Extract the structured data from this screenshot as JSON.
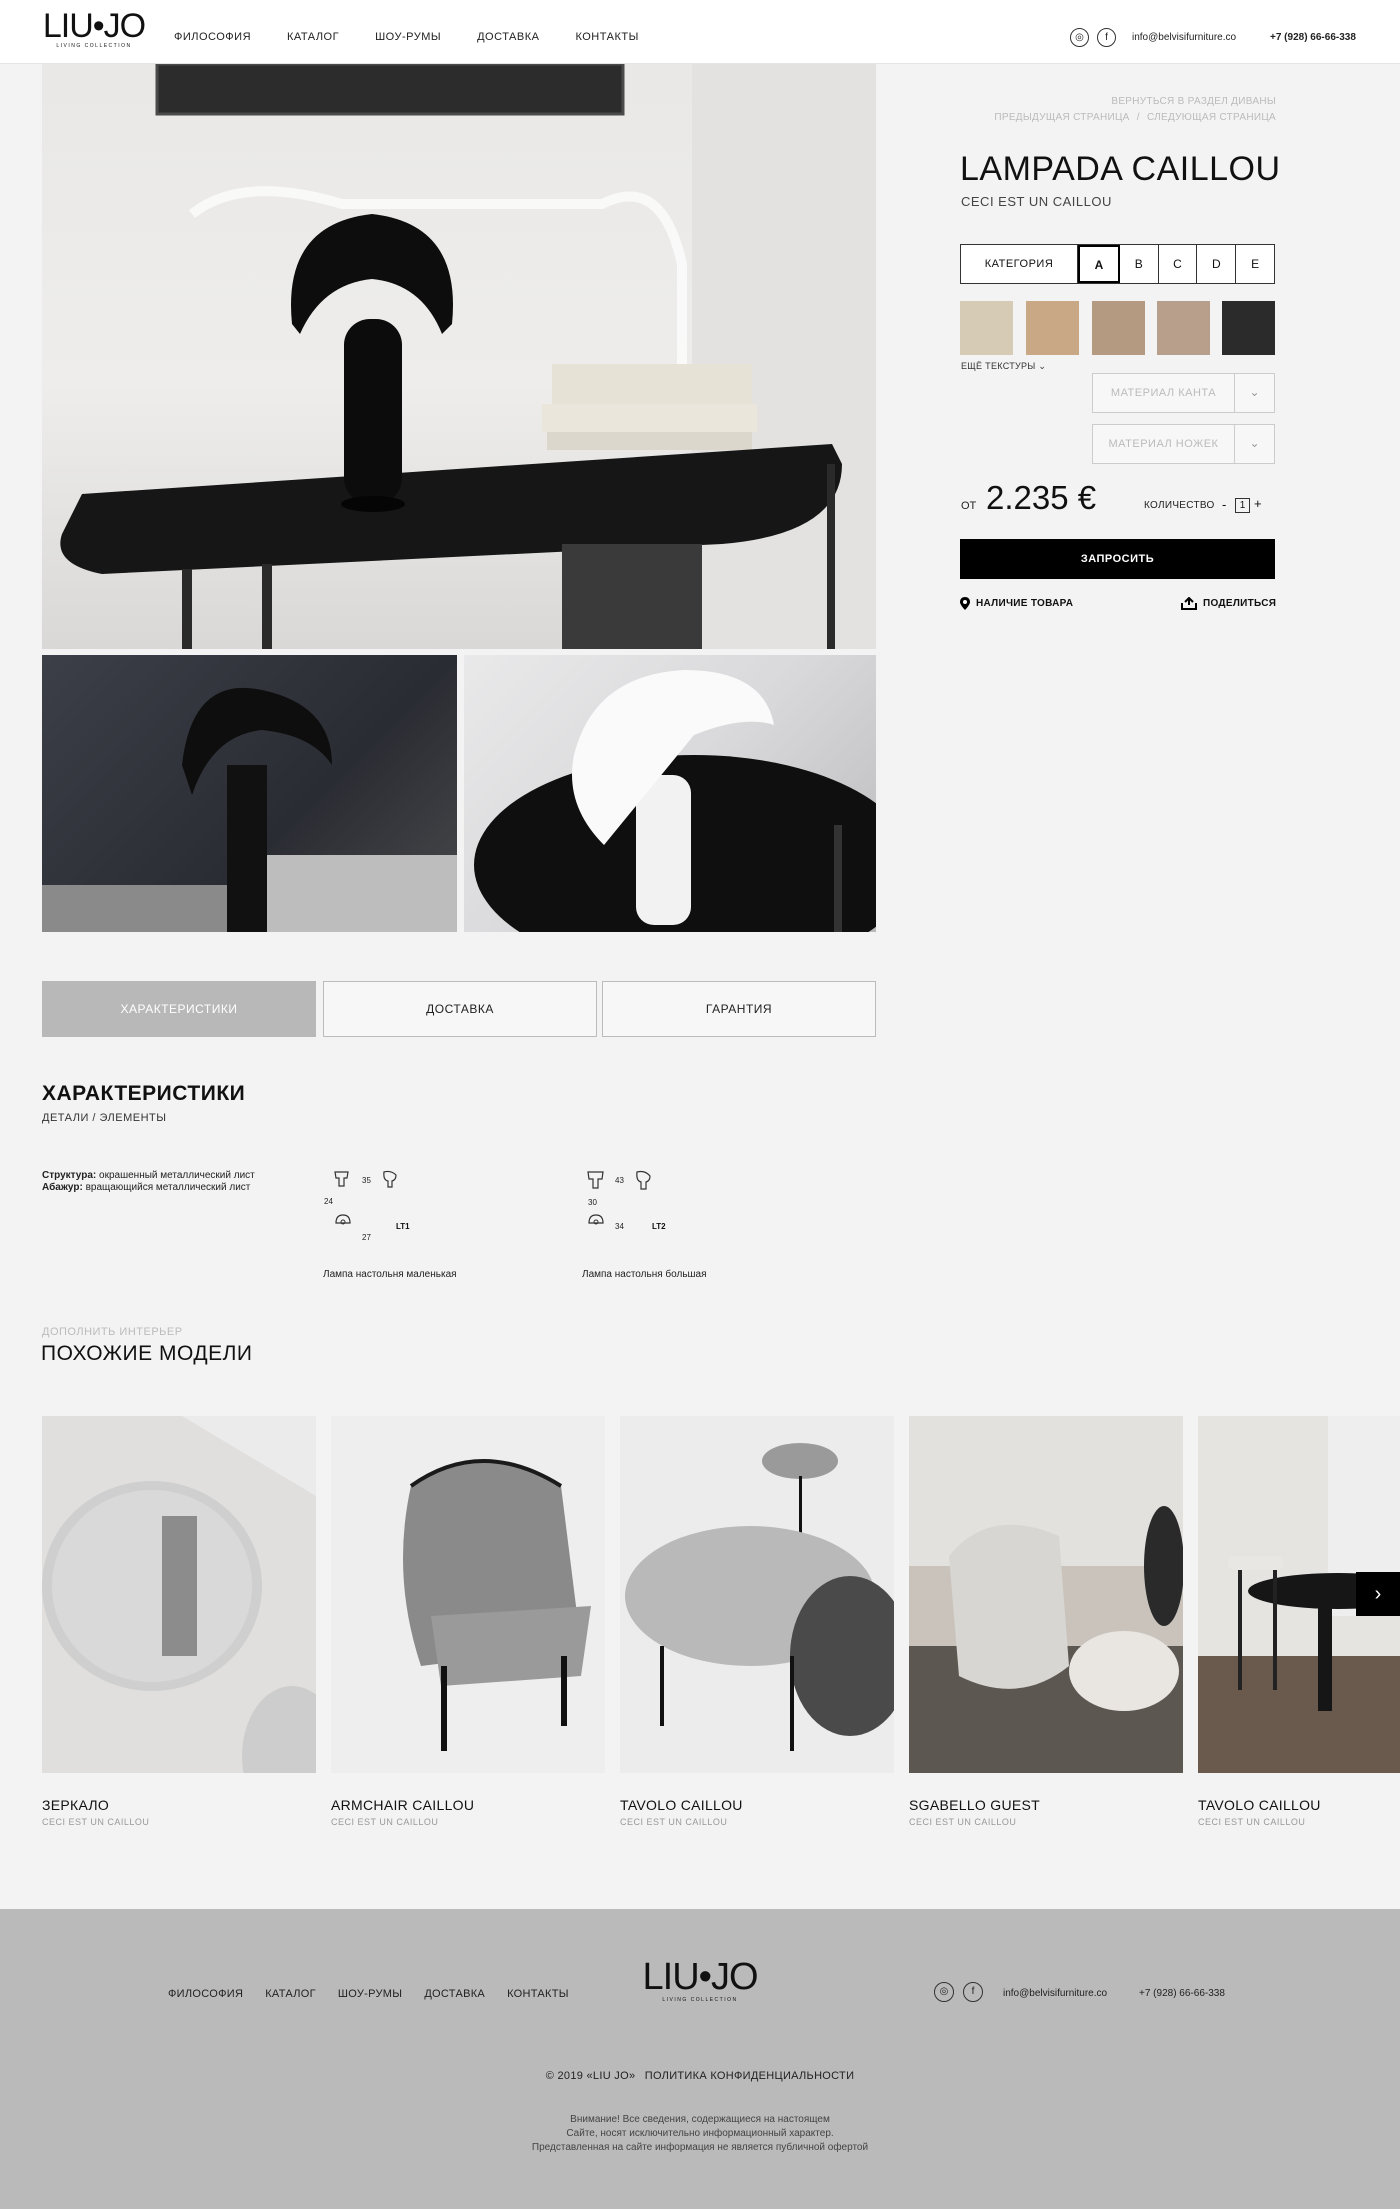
{
  "header": {
    "logo": "LIU•JO",
    "logo_sub": "LIVING COLLECTION",
    "nav": [
      "ФИЛОСОФИЯ",
      "КАТАЛОГ",
      "ШОУ-РУМЫ",
      "ДОСТАВКА",
      "КОНТАКТЫ"
    ],
    "email": "info@belvisifurniture.co",
    "phone": "+7 (928) 66-66-338"
  },
  "breadcrumbs": {
    "back": "ВЕРНУТЬСЯ В РАЗДЕЛ ДИВАНЫ",
    "prev": "ПРЕДЫДУЩАЯ СТРАНИЦА",
    "separator": "/",
    "next": "СЛЕДУЮЩАЯ СТРАНИЦА"
  },
  "product": {
    "title": "LAMPADA CAILLOU",
    "subtitle": "CECI EST UN CAILLOU",
    "category_label": "КАТЕГОРИЯ",
    "categories": [
      "A",
      "B",
      "C",
      "D",
      "E"
    ],
    "selected_category": "A",
    "swatches": [
      "#d6cbb5",
      "#c9a985",
      "#b39a81",
      "#b89f8c",
      "#2b2b2b"
    ],
    "more_textures": "ЕЩЁ ТЕКСТУРЫ",
    "edge_material": "МАТЕРИАЛ КАНТА",
    "leg_material": "МАТЕРИАЛ НОЖЕК",
    "price_from": "ОТ",
    "price": "2.235 €",
    "qty_label": "КОЛИЧЕСТВО",
    "qty_minus": "-",
    "qty": "1",
    "qty_plus": "+",
    "request_button": "ЗАПРОСИТЬ",
    "availability": "НАЛИЧИЕ ТОВАРА",
    "share": "ПОДЕЛИТЬСЯ"
  },
  "tabs": [
    {
      "label": "ХАРАКТЕРИСТИКИ",
      "active": true
    },
    {
      "label": "ДОСТАВКА",
      "active": false
    },
    {
      "label": "ГАРАНТИЯ",
      "active": false
    }
  ],
  "characteristics": {
    "title": "ХАРАКТЕРИСТИКИ",
    "subtitle": "ДЕТАЛИ / ЭЛЕМЕНТЫ",
    "structure_label": "Структура:",
    "structure_value": "окрашенный металлический лист",
    "shade_label": "Абажур:",
    "shade_value": "вращающийся металлический лист",
    "items": [
      {
        "code": "LT1",
        "d1": "35",
        "d2": "24",
        "d3": "27",
        "caption": "Лампа настольня маленькая"
      },
      {
        "code": "LT2",
        "d1": "43",
        "d2": "30",
        "d3": "34",
        "caption": "Лампа настольня большая"
      }
    ]
  },
  "similar": {
    "pretitle": "ДОПОЛНИТЬ ИНТЕРЬЕР",
    "title": "ПОХОЖИЕ МОДЕЛИ",
    "items": [
      {
        "name": "ЗЕРКАЛО",
        "sub": "CECI EST UN CAILLOU"
      },
      {
        "name": "ARMCHAIR CAILLOU",
        "sub": "CECI EST UN CAILLOU"
      },
      {
        "name": "TAVOLO CAILLOU",
        "sub": "CECI EST UN CAILLOU"
      },
      {
        "name": "SGABELLO GUEST",
        "sub": "CECI EST UN CAILLOU"
      },
      {
        "name": "TAVOLO CAILLOU",
        "sub": "CECI EST UN CAILLOU"
      }
    ]
  },
  "footer": {
    "nav": [
      "ФИЛОСОФИЯ",
      "КАТАЛОГ",
      "ШОУ-РУМЫ",
      "ДОСТАВКА",
      "КОНТАКТЫ"
    ],
    "logo": "LIU•JO",
    "logo_sub": "LIVING COLLECTION",
    "email": "info@belvisifurniture.co",
    "phone": "+7 (928) 66-66-338",
    "copyright": "© 2019 «LIU JO»",
    "privacy": "ПОЛИТИКА КОНФИДЕНЦИАЛЬНОСТИ",
    "note_1": "Внимание! Все сведения, содержащиеся на настоящем",
    "note_2": "Сайте, носят исключительно информационный характер.",
    "note_3": "Представленная на сайте информация не является публичной офертой"
  },
  "icons": {
    "instagram": "instagram-icon",
    "facebook": "facebook-icon",
    "location": "location-pin-icon",
    "share": "share-icon",
    "chevron": "chevron-down-icon",
    "next": "chevron-right-icon"
  }
}
